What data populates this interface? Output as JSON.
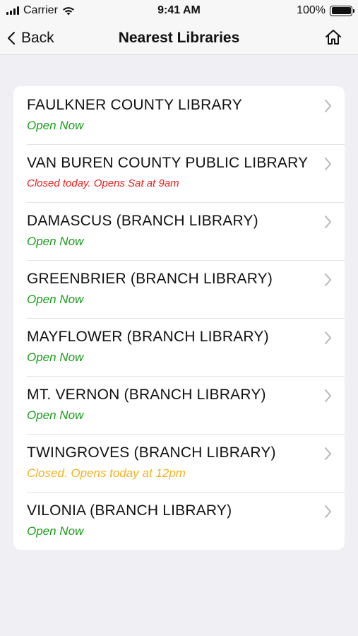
{
  "status_bar": {
    "carrier": "Carrier",
    "time": "9:41 AM",
    "battery": "100%",
    "battery_level": 1.0
  },
  "nav": {
    "back_label": "Back",
    "title": "Nearest Libraries",
    "home_icon": "home-icon"
  },
  "colors": {
    "open": "#1a9a1a",
    "closed": "#e0231e",
    "warning": "#f0b31f"
  },
  "libraries": [
    {
      "name": "FAULKNER COUNTY LIBRARY",
      "status": "Open Now",
      "status_type": "open"
    },
    {
      "name": "VAN BUREN COUNTY PUBLIC LIBRARY",
      "status": "Closed today. Opens Sat at 9am",
      "status_type": "closed"
    },
    {
      "name": "DAMASCUS (BRANCH LIBRARY)",
      "status": "Open Now",
      "status_type": "open"
    },
    {
      "name": "GREENBRIER (BRANCH LIBRARY)",
      "status": "Open Now",
      "status_type": "open"
    },
    {
      "name": "MAYFLOWER (BRANCH LIBRARY)",
      "status": "Open Now",
      "status_type": "open"
    },
    {
      "name": "MT. VERNON (BRANCH LIBRARY)",
      "status": "Open Now",
      "status_type": "open"
    },
    {
      "name": "TWINGROVES (BRANCH LIBRARY)",
      "status": "Closed. Opens today at 12pm",
      "status_type": "warning"
    },
    {
      "name": "VILONIA (BRANCH LIBRARY)",
      "status": "Open Now",
      "status_type": "open"
    }
  ]
}
